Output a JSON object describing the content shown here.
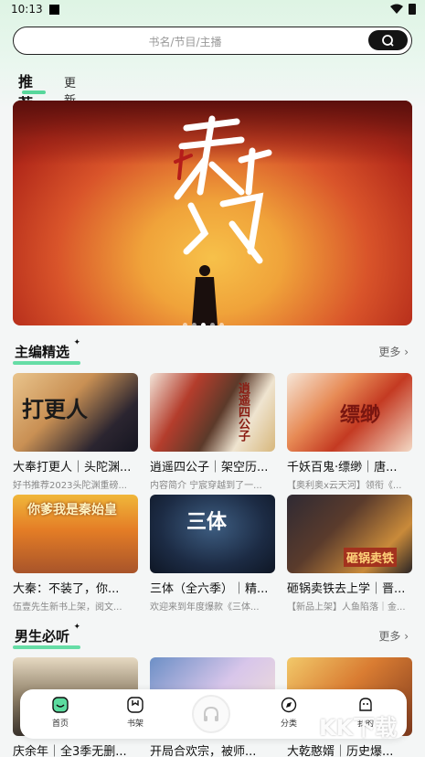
{
  "status_bar": {
    "time": "10:13"
  },
  "search": {
    "placeholder": "书名/节目/主播"
  },
  "tabs": [
    {
      "label": "推荐",
      "active": true
    },
    {
      "label": "更新",
      "active": false
    }
  ],
  "banner": {
    "dots": 5,
    "active_dot": 2
  },
  "sections": [
    {
      "title": "主编精选",
      "more": "更多",
      "items": [
        {
          "title": "大奉打更人｜头陀渊...",
          "desc": "好书推荐2023头陀渊重磅...",
          "cover_text": "打更人"
        },
        {
          "title": "逍遥四公子｜架空历...",
          "desc": "内容简介 宁宸穿越到了一...",
          "cover_text": "逍遥四公子"
        },
        {
          "title": "千妖百鬼·缥缈｜唐...",
          "desc": "【奥利奥x云天河】领衔《...",
          "cover_text": "缥缈"
        },
        {
          "title": "大秦：不装了，你...",
          "desc": "伍壹先生新书上架，阅文...",
          "cover_text": "你爹我是秦始皇"
        },
        {
          "title": "三体（全六季）｜精...",
          "desc": "欢迎来到年度爆款《三体...",
          "cover_text": "三体"
        },
        {
          "title": "砸锅卖铁去上学｜晋...",
          "desc": "【新品上架】人鱼陷落｜金...",
          "cover_text": "砸锅卖铁"
        }
      ]
    },
    {
      "title": "男生必听",
      "more": "更多",
      "items": [
        {
          "title": "庆余年｜全3季无删...",
          "desc": ""
        },
        {
          "title": "开局合欢宗，被师...",
          "desc": ""
        },
        {
          "title": "大乾憨婿｜历史爆...",
          "desc": ""
        }
      ]
    }
  ],
  "bottom_nav": [
    {
      "label": "首页",
      "icon": "home-icon",
      "active": true
    },
    {
      "label": "书架",
      "icon": "bookshelf-icon",
      "active": false
    },
    {
      "label": "",
      "icon": "headphones-icon",
      "active": false
    },
    {
      "label": "分类",
      "icon": "category-icon",
      "active": false
    },
    {
      "label": "我的",
      "icon": "profile-icon",
      "active": false
    }
  ],
  "watermark": "KK下载",
  "colors": {
    "accent": "#57d79b",
    "search_button": "#141414"
  }
}
